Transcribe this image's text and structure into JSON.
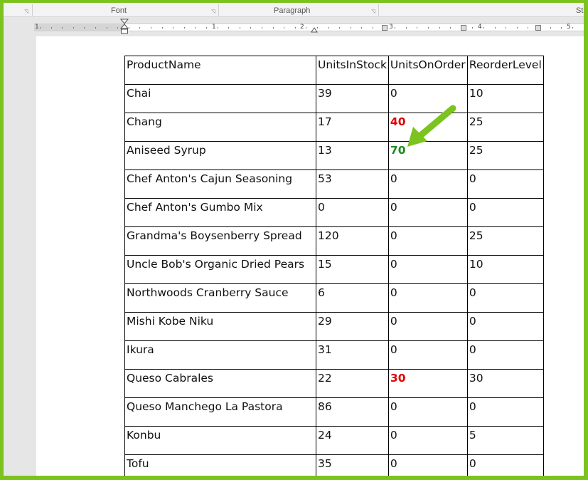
{
  "ribbon": {
    "groups": [
      {
        "label": "Font"
      },
      {
        "label": "Paragraph"
      },
      {
        "label": "St"
      }
    ]
  },
  "ruler": {
    "numbers": [
      "1",
      "1",
      "2",
      "3",
      "4",
      "5"
    ]
  },
  "table": {
    "rows": [
      {
        "cells": [
          {
            "text": "ProductName"
          },
          {
            "text": "UnitsInStock"
          },
          {
            "text": "UnitsOnOrder"
          },
          {
            "text": "ReorderLevel"
          }
        ]
      },
      {
        "cells": [
          {
            "text": "Chai"
          },
          {
            "text": "39"
          },
          {
            "text": "0"
          },
          {
            "text": "10"
          }
        ]
      },
      {
        "cells": [
          {
            "text": "Chang"
          },
          {
            "text": "17"
          },
          {
            "text": "40",
            "style": "red"
          },
          {
            "text": "25"
          }
        ]
      },
      {
        "cells": [
          {
            "text": "Aniseed Syrup"
          },
          {
            "text": "13"
          },
          {
            "text": "70",
            "style": "green"
          },
          {
            "text": "25"
          }
        ]
      },
      {
        "cells": [
          {
            "text": "Chef Anton's Cajun Seasoning"
          },
          {
            "text": "53"
          },
          {
            "text": "0"
          },
          {
            "text": "0"
          }
        ]
      },
      {
        "cells": [
          {
            "text": "Chef Anton's Gumbo Mix"
          },
          {
            "text": "0"
          },
          {
            "text": "0"
          },
          {
            "text": "0"
          }
        ]
      },
      {
        "cells": [
          {
            "text": "Grandma's Boysenberry Spread"
          },
          {
            "text": "120"
          },
          {
            "text": "0"
          },
          {
            "text": "25"
          }
        ]
      },
      {
        "cells": [
          {
            "text": "Uncle Bob's Organic Dried Pears"
          },
          {
            "text": "15"
          },
          {
            "text": "0"
          },
          {
            "text": "10"
          }
        ]
      },
      {
        "cells": [
          {
            "text": "Northwoods Cranberry Sauce"
          },
          {
            "text": "6"
          },
          {
            "text": "0"
          },
          {
            "text": "0"
          }
        ]
      },
      {
        "cells": [
          {
            "text": "Mishi Kobe Niku"
          },
          {
            "text": "29"
          },
          {
            "text": "0"
          },
          {
            "text": "0"
          }
        ]
      },
      {
        "cells": [
          {
            "text": "Ikura"
          },
          {
            "text": "31"
          },
          {
            "text": "0"
          },
          {
            "text": "0"
          }
        ]
      },
      {
        "cells": [
          {
            "text": "Queso Cabrales"
          },
          {
            "text": "22"
          },
          {
            "text": "30",
            "style": "red"
          },
          {
            "text": "30"
          }
        ]
      },
      {
        "cells": [
          {
            "text": "Queso Manchego La Pastora"
          },
          {
            "text": "86"
          },
          {
            "text": "0"
          },
          {
            "text": "0"
          }
        ]
      },
      {
        "cells": [
          {
            "text": "Konbu"
          },
          {
            "text": "24"
          },
          {
            "text": "0"
          },
          {
            "text": "5"
          }
        ]
      },
      {
        "cells": [
          {
            "text": "Tofu"
          },
          {
            "text": "35"
          },
          {
            "text": "0"
          },
          {
            "text": "0"
          }
        ]
      }
    ]
  },
  "colors": {
    "frame_border": "#7cc31f",
    "highlight_red": "#e10000",
    "highlight_green": "#1a8a1a",
    "arrow": "#7cc31f"
  },
  "icons": {
    "dialog_launcher": "dialog-launcher-icon",
    "annotation_arrow": "arrow-icon"
  }
}
